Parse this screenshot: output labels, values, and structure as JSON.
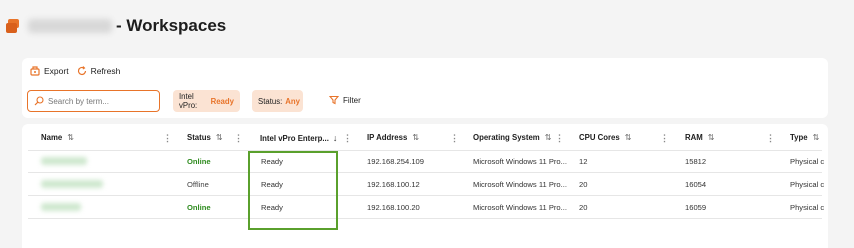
{
  "header": {
    "title": "- Workspaces"
  },
  "toolbar": {
    "export_label": "Export",
    "refresh_label": "Refresh"
  },
  "search": {
    "placeholder": "Search by term..."
  },
  "filters": {
    "intel_label": "Intel vPro:",
    "intel_value": "Ready",
    "status_label": "Status:",
    "status_value": "Any",
    "filter_label": "Filter"
  },
  "columns": [
    "Name",
    "Status",
    "Intel vPro Enterp...",
    "IP Address",
    "Operating System",
    "CPU Cores",
    "RAM",
    "Type"
  ],
  "rows": [
    {
      "status": "Online",
      "intel": "Ready",
      "ip": "192.168.254.109",
      "os": "Microsoft Windows 11 Pro...",
      "cpu": "12",
      "ram": "15812",
      "type": "Physical c"
    },
    {
      "status": "Offline",
      "intel": "Ready",
      "ip": "192.168.100.12",
      "os": "Microsoft Windows 11 Pro...",
      "cpu": "20",
      "ram": "16054",
      "type": "Physical c"
    },
    {
      "status": "Online",
      "intel": "Ready",
      "ip": "192.168.100.20",
      "os": "Microsoft Windows 11 Pro...",
      "cpu": "20",
      "ram": "16059",
      "type": "Physical c"
    }
  ],
  "colors": {
    "accent": "#e8742a",
    "online": "#2e8b1e",
    "highlight": "#5aa02c"
  }
}
